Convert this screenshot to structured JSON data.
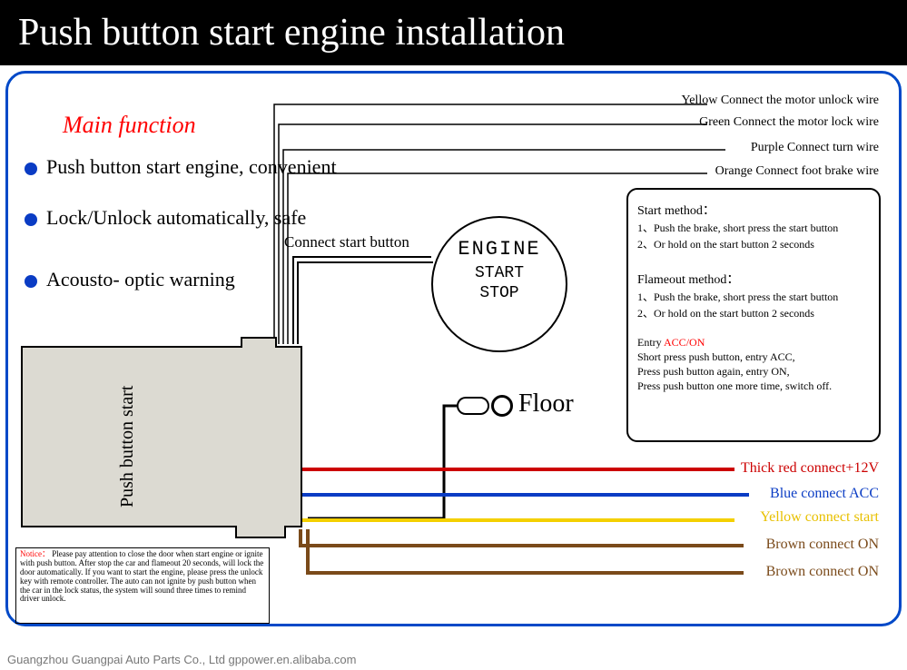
{
  "title": "Push button start engine installation",
  "main_function_heading": "Main function",
  "bullets": [
    "Push button start engine, convenient",
    "Lock/Unlock automatically, safe",
    "Acousto- optic warning"
  ],
  "module_label": "Push button start",
  "connect_start_button_label": "Connect start button",
  "engine_button": {
    "line1": "ENGINE",
    "line2": "START",
    "line3": "STOP"
  },
  "floor_label": "Floor",
  "top_wires": [
    "Yellow Connect the motor unlock wire",
    "Green Connect the motor lock wire",
    "Purple Connect turn wire",
    "Orange Connect foot brake wire"
  ],
  "bottom_wires": [
    {
      "text": "Thick red connect+12V"
    },
    {
      "text": "Blue connect ACC"
    },
    {
      "text": "Yellow connect start"
    },
    {
      "text": "Brown connect ON"
    },
    {
      "text": "Brown connect ON"
    }
  ],
  "instructions": {
    "start_heading": "Start method：",
    "start_1": "1、Push the brake, short press the start button",
    "start_2": "2、Or hold on the start button 2 seconds",
    "flame_heading": "Flameout method：",
    "flame_1": "1、Push the brake,  short press the start button",
    "flame_2": "2、Or hold on the start button 2 seconds",
    "entry_label": "Entry",
    "acc_on": "ACC/ON",
    "entry_1": "Short press push button, entry ACC,",
    "entry_2": "Press push button again, entry ON,",
    "entry_3": "Press push button one more time, switch off."
  },
  "notice": {
    "label": "Notice：",
    "text": "Please pay attention to close the door when start engine or ignite with push button. After stop the car and flameout 20 seconds, will lock the door automatically. If you want to start the engine, please press the unlock key with remote controller. The auto can not ignite by push button when the car in the lock status, the system will sound three times to remind driver unlock."
  },
  "footer_left": "Guangzhou Guangpai Auto Parts Co., Ltd    gppower.en.alibaba.com",
  "footer_right": " "
}
